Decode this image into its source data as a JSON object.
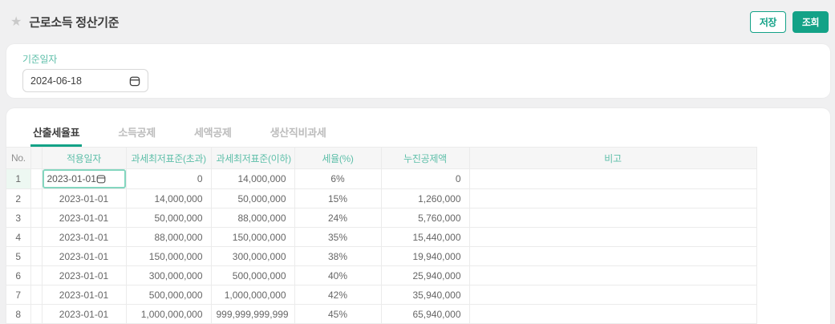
{
  "page": {
    "title": "근로소득 정산기준",
    "accent_color": "#13a287",
    "header_teal": "#5ebfa9"
  },
  "toolbar": {
    "save_label": "저장",
    "search_label": "조회"
  },
  "filter": {
    "date_label": "기준일자",
    "date_value": "2024-06-18"
  },
  "tabs": [
    {
      "label": "산출세율표",
      "active": true
    },
    {
      "label": "소득공제",
      "active": false
    },
    {
      "label": "세액공제",
      "active": false
    },
    {
      "label": "생산직비과세",
      "active": false
    }
  ],
  "table": {
    "columns": [
      "No.",
      "적용일자",
      "과세최저표준(초과)",
      "과세최저표준(이하)",
      "세율(%)",
      "누진공제액",
      "비고"
    ],
    "rows": [
      {
        "no": "1",
        "date": "2023-01-01",
        "over": "0",
        "under": "14,000,000",
        "rate": "6%",
        "deduction": "0",
        "note": "",
        "editing": true
      },
      {
        "no": "2",
        "date": "2023-01-01",
        "over": "14,000,000",
        "under": "50,000,000",
        "rate": "15%",
        "deduction": "1,260,000",
        "note": ""
      },
      {
        "no": "3",
        "date": "2023-01-01",
        "over": "50,000,000",
        "under": "88,000,000",
        "rate": "24%",
        "deduction": "5,760,000",
        "note": ""
      },
      {
        "no": "4",
        "date": "2023-01-01",
        "over": "88,000,000",
        "under": "150,000,000",
        "rate": "35%",
        "deduction": "15,440,000",
        "note": ""
      },
      {
        "no": "5",
        "date": "2023-01-01",
        "over": "150,000,000",
        "under": "300,000,000",
        "rate": "38%",
        "deduction": "19,940,000",
        "note": ""
      },
      {
        "no": "6",
        "date": "2023-01-01",
        "over": "300,000,000",
        "under": "500,000,000",
        "rate": "40%",
        "deduction": "25,940,000",
        "note": ""
      },
      {
        "no": "7",
        "date": "2023-01-01",
        "over": "500,000,000",
        "under": "1,000,000,000",
        "rate": "42%",
        "deduction": "35,940,000",
        "note": ""
      },
      {
        "no": "8",
        "date": "2023-01-01",
        "over": "1,000,000,000",
        "under": "999,999,999,999",
        "rate": "45%",
        "deduction": "65,940,000",
        "note": ""
      }
    ]
  }
}
